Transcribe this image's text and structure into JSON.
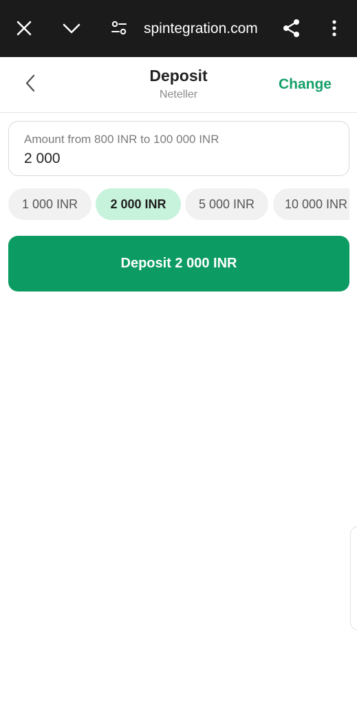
{
  "browser": {
    "url": "spintegration.com",
    "icons": {
      "close": "close-icon",
      "chevron": "chevron-down-icon",
      "tune": "page-settings-icon",
      "share": "share-icon",
      "more": "more-vert-icon"
    }
  },
  "header": {
    "title": "Deposit",
    "subtitle": "Neteller",
    "change_label": "Change",
    "back_icon": "chevron-left-icon"
  },
  "amount": {
    "label": "Amount from 800 INR to 100 000 INR",
    "value": "2 000"
  },
  "chips": [
    {
      "label": "1 000 INR",
      "selected": false
    },
    {
      "label": "2 000 INR",
      "selected": true
    },
    {
      "label": "5 000 INR",
      "selected": false
    },
    {
      "label": "10 000 INR",
      "selected": false
    }
  ],
  "deposit_button": {
    "label": "Deposit 2 000 INR"
  },
  "colors": {
    "accent": "#0c9b63",
    "change_text": "#16a06a",
    "chip_selected": "#c7f3dc",
    "toolbar": "#1b1b1b"
  }
}
